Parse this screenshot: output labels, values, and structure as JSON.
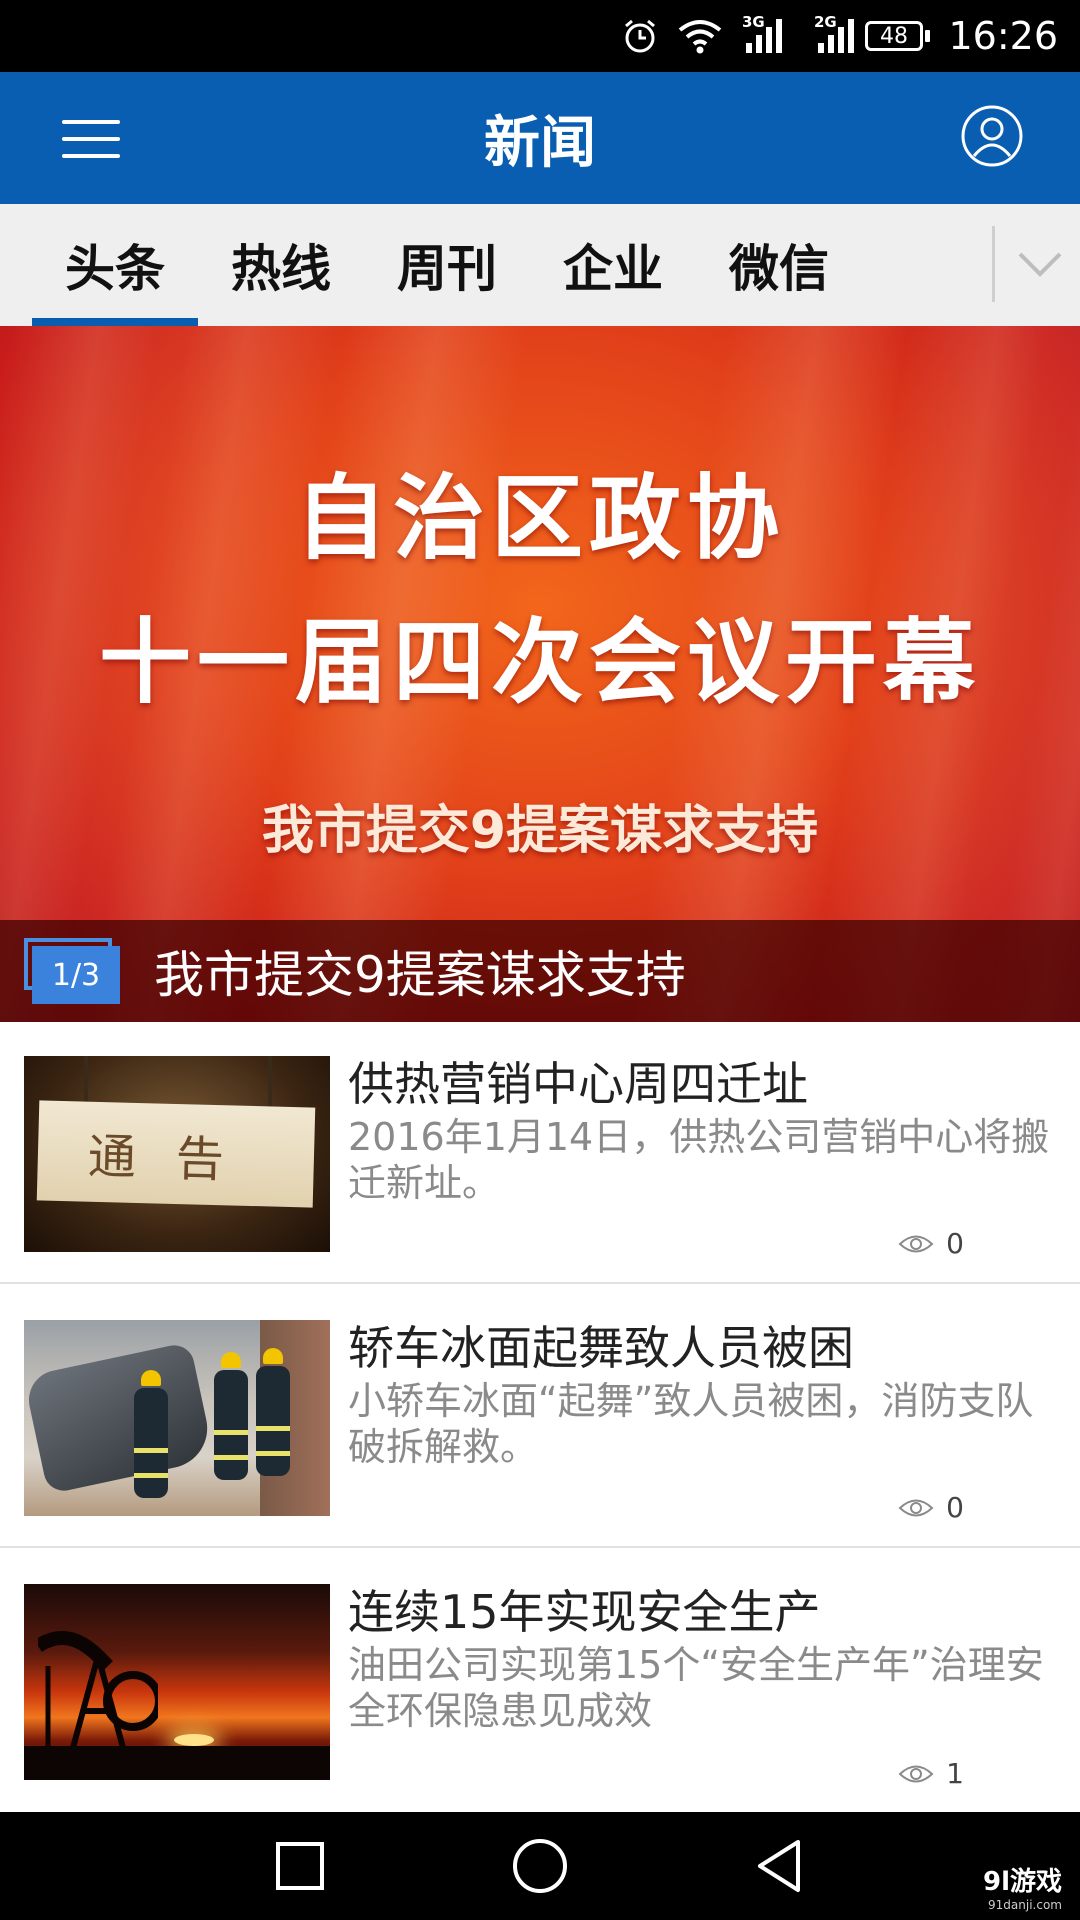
{
  "status_bar": {
    "time": "16:26",
    "battery": "48",
    "signal1_label": "3G",
    "signal2_label": "2G",
    "icons": [
      "alarm-icon",
      "wifi-icon",
      "signal-icon",
      "signal-icon",
      "battery-icon"
    ]
  },
  "app_bar": {
    "title": "新闻",
    "menu_icon": "menu-icon",
    "user_icon": "user-icon"
  },
  "tabs": [
    {
      "label": "头条",
      "active": true
    },
    {
      "label": "热线",
      "active": false
    },
    {
      "label": "周刊",
      "active": false
    },
    {
      "label": "企业",
      "active": false
    },
    {
      "label": "微信",
      "active": false
    }
  ],
  "banner": {
    "line1": "自治区政协",
    "line2": "十一届四次会议开幕",
    "line3": "我市提交9提案谋求支持",
    "counter": "1/3",
    "caption": "我市提交9提案谋求支持"
  },
  "news": [
    {
      "title": "供热营销中心周四迁址",
      "desc": "2016年1月14日，供热公司营销中心将搬迁新址。",
      "views": "0",
      "thumb_text": "通告"
    },
    {
      "title": "轿车冰面起舞致人员被困",
      "desc": "小轿车冰面“起舞”致人员被困，消防支队破拆解救。",
      "views": "0"
    },
    {
      "title": "连续15年实现安全生产",
      "desc": "油田公司实现第15个“安全生产年”治理安全环保隐患见成效",
      "views": "1"
    }
  ],
  "nav_bar": {
    "icons": [
      "recent-apps-icon",
      "home-icon",
      "back-icon"
    ],
    "watermark": "9l游戏",
    "watermark_url": "91danji.com"
  },
  "colors": {
    "brand": "#0a5eb1",
    "tab_bg": "#efefef",
    "banner_red": "#d42a1c"
  }
}
